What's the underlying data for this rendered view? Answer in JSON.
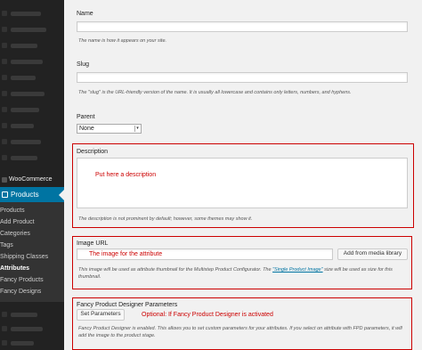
{
  "sidebar": {
    "woocommerce": "WooCommerce",
    "products": "Products",
    "submenu": [
      "Products",
      "Add Product",
      "Categories",
      "Tags",
      "Shipping Classes",
      "Attributes",
      "Fancy Products",
      "Fancy Designs"
    ],
    "current": "Attributes"
  },
  "name_field": {
    "label": "Name",
    "value": "",
    "help": "The name is how it appears on your site."
  },
  "slug_field": {
    "label": "Slug",
    "value": "",
    "help": "The \"slug\" is the URL-friendly version of the name. It is usually all lowercase and contains only letters, numbers, and hyphens."
  },
  "parent_field": {
    "label": "Parent",
    "selected": "None"
  },
  "description_field": {
    "label": "Description",
    "note": "Put here a description",
    "help": "The description is not prominent by default; however, some themes may show it."
  },
  "image_url_field": {
    "label": "Image URL",
    "note": "The image for the attribute",
    "button": "Add from media library",
    "help_before": "This image will be used as attribute thumbnail for the Multistep Product Configurator. The ",
    "help_link": "\"Single Product Image\"",
    "help_after": " size will be used as size for this thumbnail."
  },
  "fpd_field": {
    "label": "Fancy Product Designer Parameters",
    "button": "Set Parameters",
    "note": "Optional: If Fancy Product Designer is activated",
    "help": "Fancy Product Designer is enabled. This allows you to set custom parameters for your attributes. If you select on attribute with FPD parameters, it will add the image to the product stage."
  },
  "colors": {
    "sidebar_bg": "#222222",
    "accent": "#0074a2",
    "annotation": "#cc0000"
  }
}
